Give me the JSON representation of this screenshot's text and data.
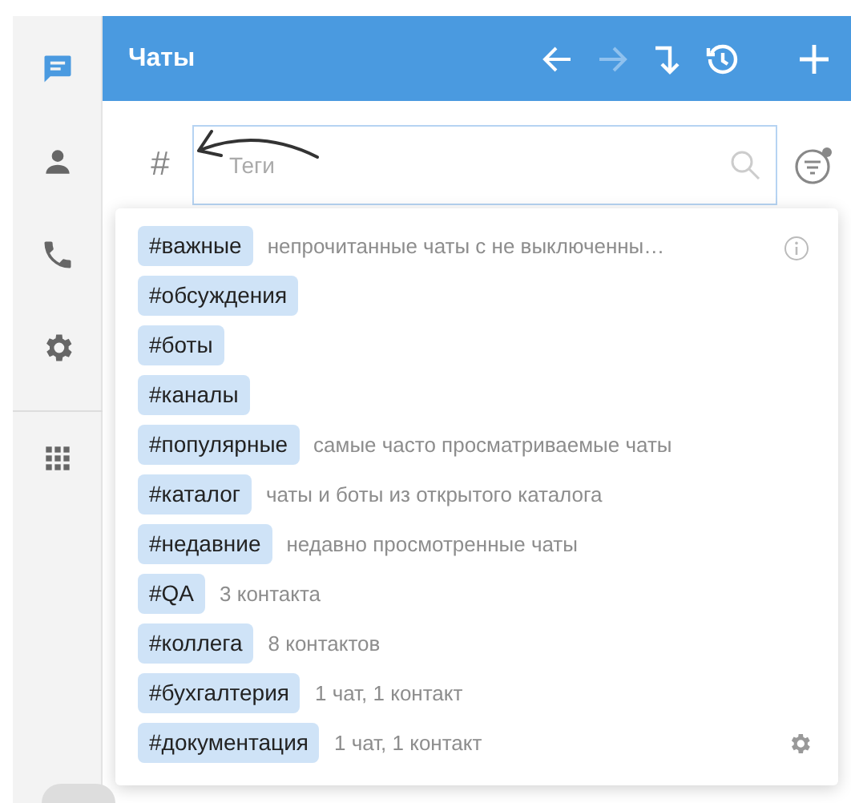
{
  "header": {
    "title": "Чаты",
    "actions": [
      {
        "kind": "back",
        "disabled": false
      },
      {
        "kind": "forward",
        "disabled": true
      },
      {
        "kind": "jump",
        "disabled": false
      },
      {
        "kind": "history",
        "disabled": false
      },
      {
        "kind": "add",
        "disabled": false
      }
    ]
  },
  "sidebar": {
    "items": [
      {
        "kind": "chats",
        "selected": true
      },
      {
        "kind": "contacts",
        "selected": false
      },
      {
        "kind": "calls",
        "selected": false
      },
      {
        "kind": "settings",
        "selected": false
      },
      {
        "kind": "apps",
        "selected": false
      }
    ]
  },
  "search": {
    "prefix": "#",
    "placeholder": "Теги"
  },
  "tags": [
    {
      "tag": "#важные",
      "description": "непрочитанные чаты с не выключенны…"
    },
    {
      "tag": "#обсуждения"
    },
    {
      "tag": "#боты"
    },
    {
      "tag": "#каналы"
    },
    {
      "tag": "#популярные",
      "description": "самые часто просматриваемые чаты"
    },
    {
      "tag": "#каталог",
      "description": "чаты и боты из открытого каталога"
    },
    {
      "tag": "#недавние",
      "description": "недавно просмотренные чаты"
    },
    {
      "tag": "#QA",
      "description": "3 контакта"
    },
    {
      "tag": "#коллега",
      "description": "8 контактов"
    },
    {
      "tag": "#бухгалтерия",
      "description": "1 чат, 1 контакт"
    },
    {
      "tag": "#документация",
      "description": "1 чат, 1 контакт"
    }
  ]
}
